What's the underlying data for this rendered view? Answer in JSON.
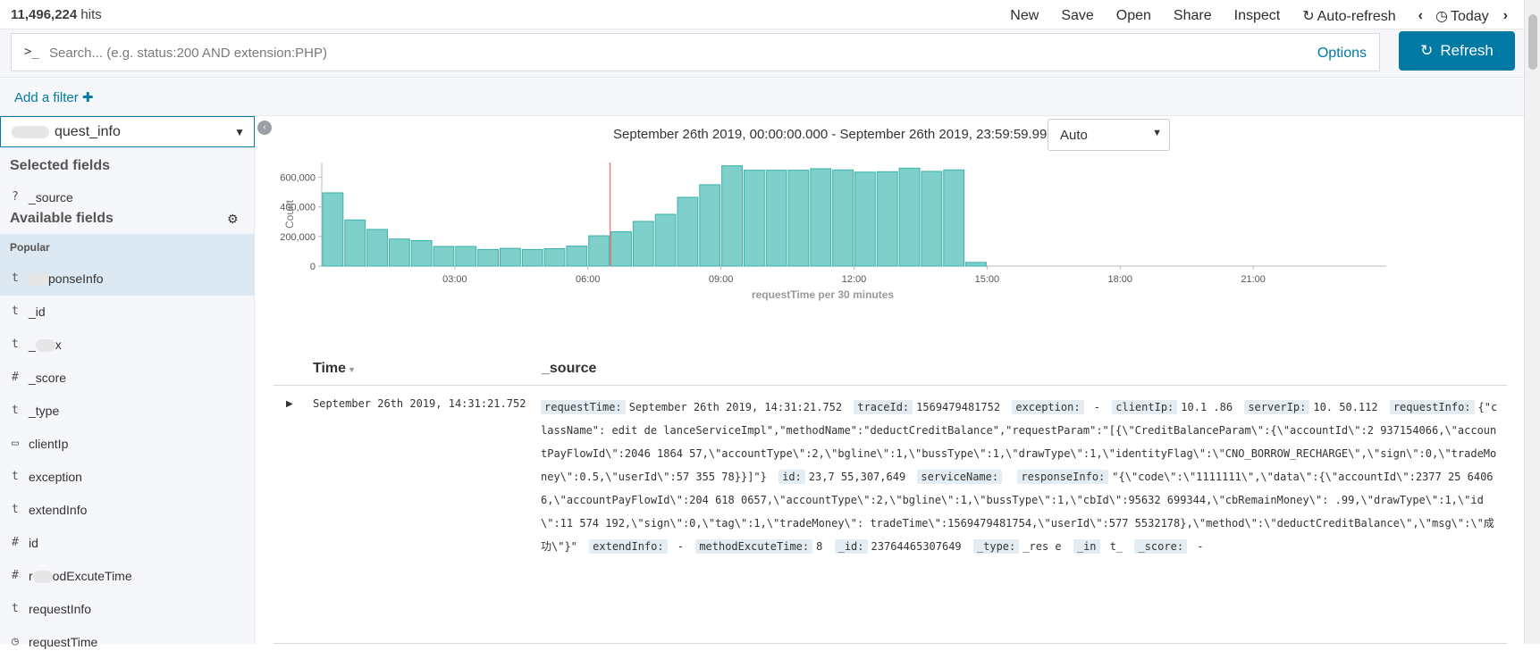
{
  "topbar": {
    "hits_count": "11,496,224",
    "hits_label": " hits",
    "menu": [
      "New",
      "Save",
      "Open",
      "Share",
      "Inspect"
    ],
    "auto_refresh": "Auto-refresh",
    "today": "Today"
  },
  "search": {
    "prompt": ">_",
    "placeholder": "Search... (e.g. status:200 AND extension:PHP)",
    "options": "Options",
    "refresh": "Refresh"
  },
  "filter": {
    "add_label": "Add a filter"
  },
  "sidebar": {
    "index": "quest_info",
    "selected_heading": "Selected fields",
    "selected_fields": [
      {
        "type": "?",
        "name": "_source"
      }
    ],
    "available_heading": "Available fields",
    "popular_label": "Popular",
    "fields": [
      {
        "type": "t",
        "name": "ponseInfo"
      },
      {
        "type": "t",
        "name": "_id"
      },
      {
        "type": "t",
        "name": "x"
      },
      {
        "type": "#",
        "name": "_score"
      },
      {
        "type": "t",
        "name": "_type"
      },
      {
        "type": "▭",
        "name": "clientIp"
      },
      {
        "type": "t",
        "name": "ception"
      },
      {
        "type": "t",
        "name": "extendInfo"
      },
      {
        "type": "#",
        "name": "id"
      },
      {
        "type": "#",
        "name": "odExcuteTime"
      },
      {
        "type": "t",
        "name": "requestInfo"
      },
      {
        "type": "◷",
        "name": "requestTime"
      }
    ]
  },
  "main": {
    "time_range": "September 26th 2019, 00:00:00.000 - September 26th 2019, 23:59:59.999 —",
    "interval": "Auto"
  },
  "chart_data": {
    "type": "bar",
    "ylabel": "Count",
    "xlabel": "requestTime per 30 minutes",
    "y_ticks": [
      "0",
      "200,000",
      "400,000",
      "600,000"
    ],
    "x_ticks": [
      "03:00",
      "06:00",
      "09:00",
      "12:00",
      "15:00",
      "18:00",
      "21:00"
    ],
    "ylim": [
      0,
      700000
    ],
    "x_range_hours": [
      0,
      24
    ],
    "bucket_hours": 0.5,
    "values": [
      495000,
      312000,
      248000,
      183000,
      172000,
      133000,
      133000,
      112000,
      120000,
      112000,
      118000,
      135000,
      205000,
      232000,
      302000,
      350000,
      465000,
      550000,
      678000,
      648000,
      648000,
      648000,
      658000,
      650000,
      635000,
      638000,
      662000,
      640000,
      650000,
      25000
    ],
    "marker_hour": 6.5,
    "bar_color": "#7fd0cb",
    "bar_edge": "#3ab1a8",
    "marker_color": "#f08080"
  },
  "table": {
    "time_header": "Time",
    "source_header": "_source",
    "rows": [
      {
        "time": "September 26th 2019, 14:31:21.752",
        "source_lines": [
          {
            "k": "requestTime:",
            "v": "September 26th 2019, 14:31:21.752"
          },
          {
            "k": "traceId:",
            "v": "1569479481752"
          },
          {
            "k": "exception:",
            "v": " - "
          },
          {
            "k": "clientIp:",
            "v": "10.1 .86"
          },
          {
            "k": "serverIp:",
            "v": "10. 50.112"
          },
          {
            "k": "requestInfo:",
            "v": "{\"className\": edit de lanceServiceImpl\",\"methodName\":\"deductCreditBalance\",\"requestParam\":\"[{\\\"CreditBalanceParam\\\":{\\\"accountId\\\":2 937154066,\\\"accountPayFlowId\\\":2046 1864 57,\\\"accountType\\\":2,\\\"bgline\\\":1,\\\"bussType\\\":1,\\\"drawType\\\":1,\\\"identityFlag\\\":\\\"CNO_BORROW_RECHARGE\\\",\\\"sign\\\":0,\\\"tradeMoney\\\":0.5,\\\"userId\\\":57 355 78}}]\"}"
          },
          {
            "k": "id:",
            "v": "23,7 55,307,649"
          },
          {
            "k": "serviceName:",
            "v": ""
          },
          {
            "k": "responseInfo:",
            "v": "\"{\\\"code\\\":\\\"1111111\\\",\\\"data\\\":{\\\"accountId\\\":2377 25 64066,\\\"accountPayFlowId\\\":204 618 0657,\\\"accountType\\\":2,\\\"bgline\\\":1,\\\"bussType\\\":1,\\\"cbId\\\":95632 699344,\\\"cbRemainMoney\\\": .99,\\\"drawType\\\":1,\\\"id\\\":11 574 192,\\\"sign\\\":0,\\\"tag\\\":1,\\\"tradeMoney\\\": tradeTime\\\":1569479481754,\\\"userId\\\":577 5532178},\\\"method\\\":\\\"deductCreditBalance\\\",\\\"msg\\\":\\\"成功\\\"}\""
          },
          {
            "k": "extendInfo:",
            "v": " - "
          },
          {
            "k": "methodExcuteTime:",
            "v": "8"
          },
          {
            "k": "_id:",
            "v": "23764465307649"
          },
          {
            "k": "_type:",
            "v": "_res e"
          },
          {
            "k": "_in",
            "v": " t_"
          },
          {
            "k": "_score:",
            "v": " - "
          }
        ]
      }
    ]
  }
}
